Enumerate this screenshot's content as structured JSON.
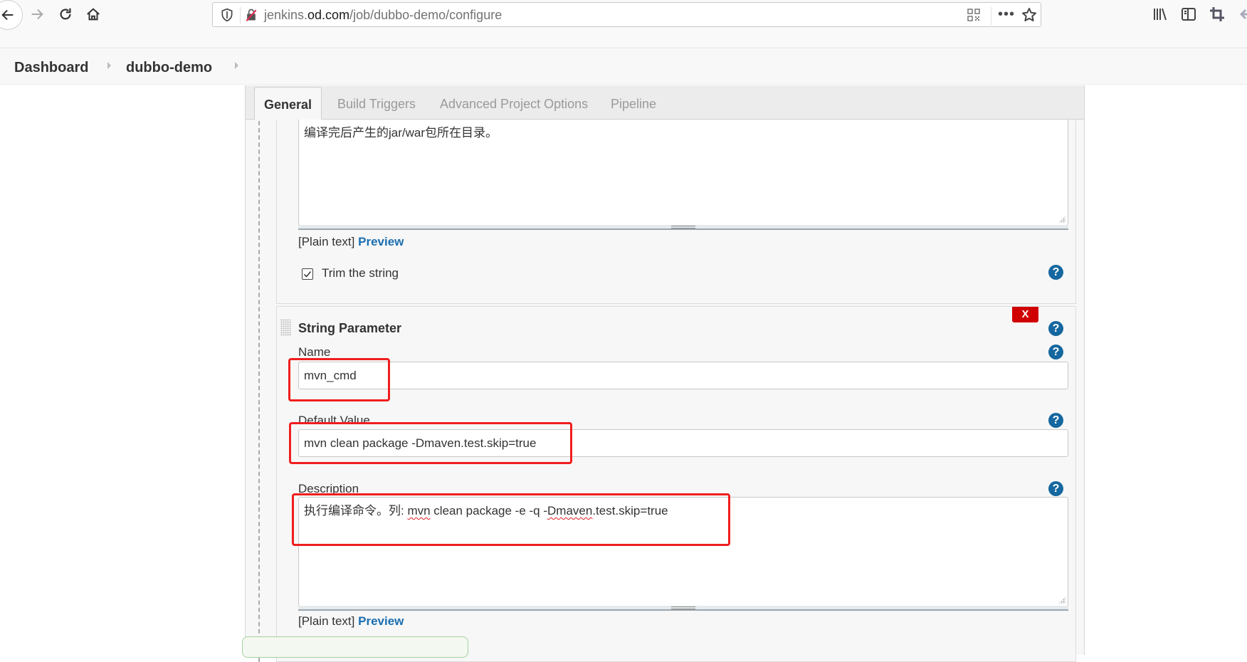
{
  "browser": {
    "url_prefix": "jenkins.",
    "url_domain": "od.com",
    "url_path": "/job/dubbo-demo/configure",
    "more_label": "•••",
    "icons": [
      "back-icon",
      "forward-icon",
      "reload-icon",
      "home-icon",
      "tracking-shield-icon",
      "insecure-lock-icon",
      "qr-code-icon",
      "more-icon",
      "bookmark-star-icon",
      "library-icon",
      "sidebar-icon",
      "screenshot-crop-icon",
      "extension-icon"
    ]
  },
  "breadcrumb": {
    "items": [
      "Dashboard",
      "dubbo-demo"
    ]
  },
  "tabs": [
    "General",
    "Build Triggers",
    "Advanced Project Options",
    "Pipeline"
  ],
  "active_tab": "General",
  "previous_parameter": {
    "description": "编译完后产生的jar/war包所在目录。",
    "format_label": "[Plain text]",
    "preview_label": "Preview",
    "trim_label": "Trim the string",
    "trim_checked": true
  },
  "string_parameter": {
    "title": "String Parameter",
    "delete_label": "X",
    "name_label": "Name",
    "name_value": "mvn_cmd",
    "default_label": "Default Value",
    "default_value": "mvn clean package -Dmaven.test.skip=true",
    "description_label": "Description",
    "description_parts": {
      "prefix": "执行编译命令。列: ",
      "word1": "mvn",
      "middle": " clean package -e -q -",
      "word2": "Dmaven",
      "suffix": ".test.skip=true"
    },
    "format_label": "[Plain text]",
    "preview_label": "Preview",
    "help_label": "?"
  },
  "colors": {
    "accent_link": "#1a6eb0",
    "help_icon": "#15679f",
    "delete_button": "#d00000",
    "annotation": "#f01e1e"
  }
}
